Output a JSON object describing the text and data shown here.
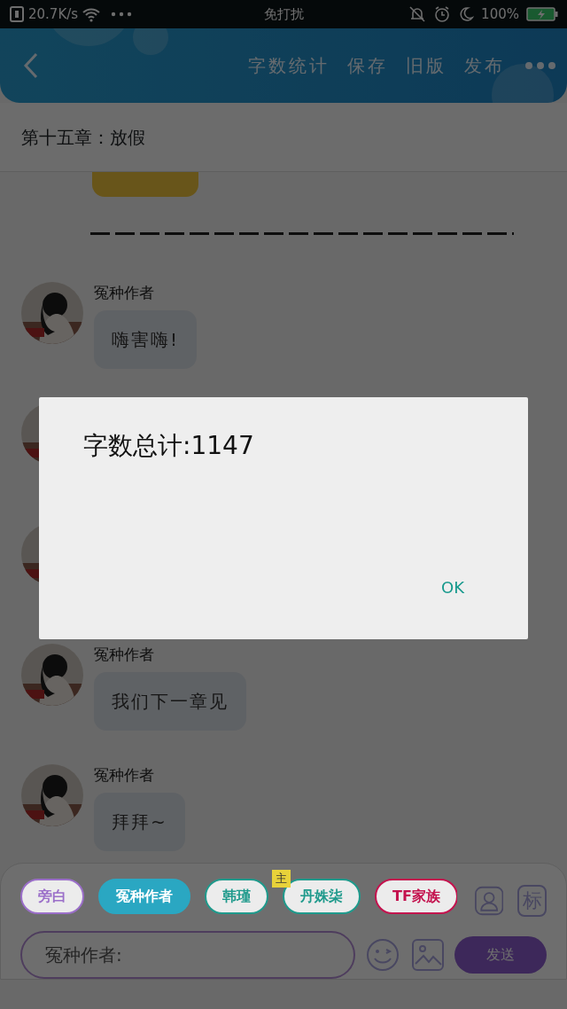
{
  "status_bar": {
    "speed": "20.7K/s",
    "mode": "免打扰",
    "battery": "100%"
  },
  "header": {
    "actions": [
      "字数统计",
      "保存",
      "旧版",
      "发布"
    ]
  },
  "chapter_title": "第十五章：放假",
  "messages": [
    {
      "kind": "cut_bubble"
    },
    {
      "kind": "separator"
    },
    {
      "kind": "message",
      "name": "冤种作者",
      "text": "嗨害嗨!"
    },
    {
      "kind": "message"
    },
    {
      "kind": "message"
    },
    {
      "kind": "message",
      "name": "冤种作者",
      "text": "我们下一章见"
    },
    {
      "kind": "message",
      "name": "冤种作者",
      "text": "拜拜~"
    }
  ],
  "roles": [
    {
      "label": "旁白",
      "color": "#9b6fc9",
      "selected": false
    },
    {
      "label": "冤种作者",
      "color": "#2aa7c2",
      "selected": true
    },
    {
      "label": "韩瑾",
      "color": "#1f9a8c",
      "selected": false
    },
    {
      "label": "丹姝柒",
      "color": "#1f9a8c",
      "selected": false,
      "badge": "主"
    },
    {
      "label": "TF家族",
      "color": "#c4124e",
      "selected": false
    }
  ],
  "mark_button": "标",
  "input": {
    "placeholder": "冤种作者:"
  },
  "send_button": "发送",
  "dialog": {
    "message": "字数总计:1147",
    "ok": "OK"
  }
}
